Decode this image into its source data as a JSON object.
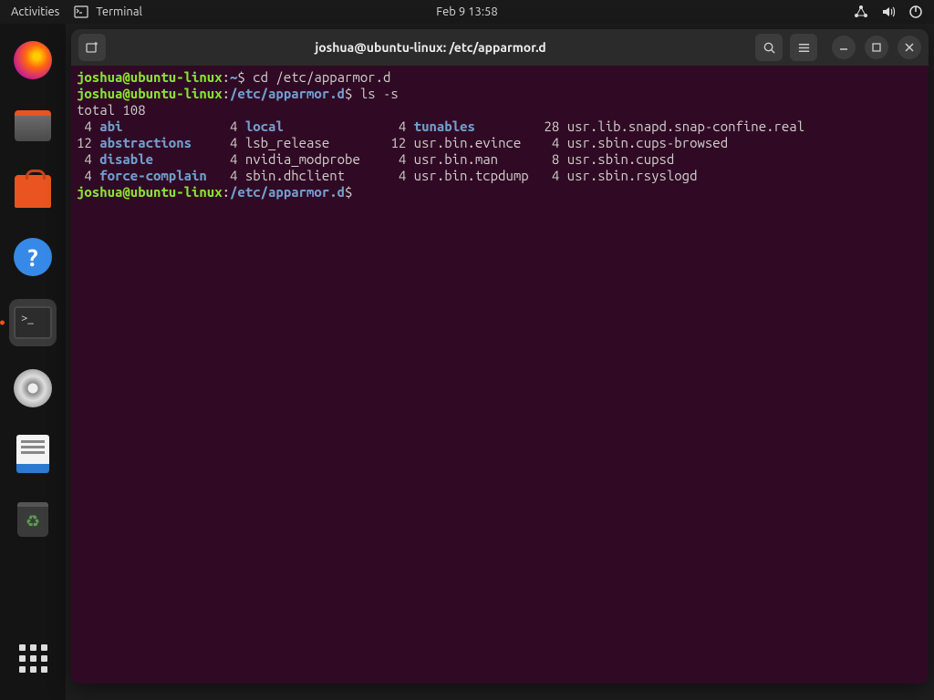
{
  "topbar": {
    "activities": "Activities",
    "app_name": "Terminal",
    "datetime": "Feb 9  13:58"
  },
  "window": {
    "title": "joshua@ubuntu-linux: /etc/apparmor.d"
  },
  "terminal": {
    "user_host": "joshua@ubuntu-linux",
    "path_home": "~",
    "path_cwd": "/etc/apparmor.d",
    "prompt_char": "$",
    "cmd1": "cd /etc/apparmor.d",
    "cmd2": "ls -s",
    "total_line": "total 108",
    "listing": [
      {
        "s1": " 4",
        "n1": "abi",
        "d1": true,
        "s2": "4",
        "n2": "local",
        "d2": true,
        "s3": " 4",
        "n3": "tunables",
        "d3": true,
        "s4": "28",
        "n4": "usr.lib.snapd.snap-confine.real"
      },
      {
        "s1": "12",
        "n1": "abstractions",
        "d1": true,
        "s2": "4",
        "n2": "lsb_release",
        "d2": false,
        "s3": "12",
        "n3": "usr.bin.evince",
        "d3": false,
        "s4": " 4",
        "n4": "usr.sbin.cups-browsed"
      },
      {
        "s1": " 4",
        "n1": "disable",
        "d1": true,
        "s2": "4",
        "n2": "nvidia_modprobe",
        "d2": false,
        "s3": " 4",
        "n3": "usr.bin.man",
        "d3": false,
        "s4": " 8",
        "n4": "usr.sbin.cupsd"
      },
      {
        "s1": " 4",
        "n1": "force-complain",
        "d1": true,
        "s2": "4",
        "n2": "sbin.dhclient",
        "d2": false,
        "s3": " 4",
        "n3": "usr.bin.tcpdump",
        "d3": false,
        "s4": " 4",
        "n4": "usr.sbin.rsyslogd"
      }
    ],
    "col_widths": {
      "n1": 14,
      "n2": 17,
      "n3": 15
    }
  }
}
